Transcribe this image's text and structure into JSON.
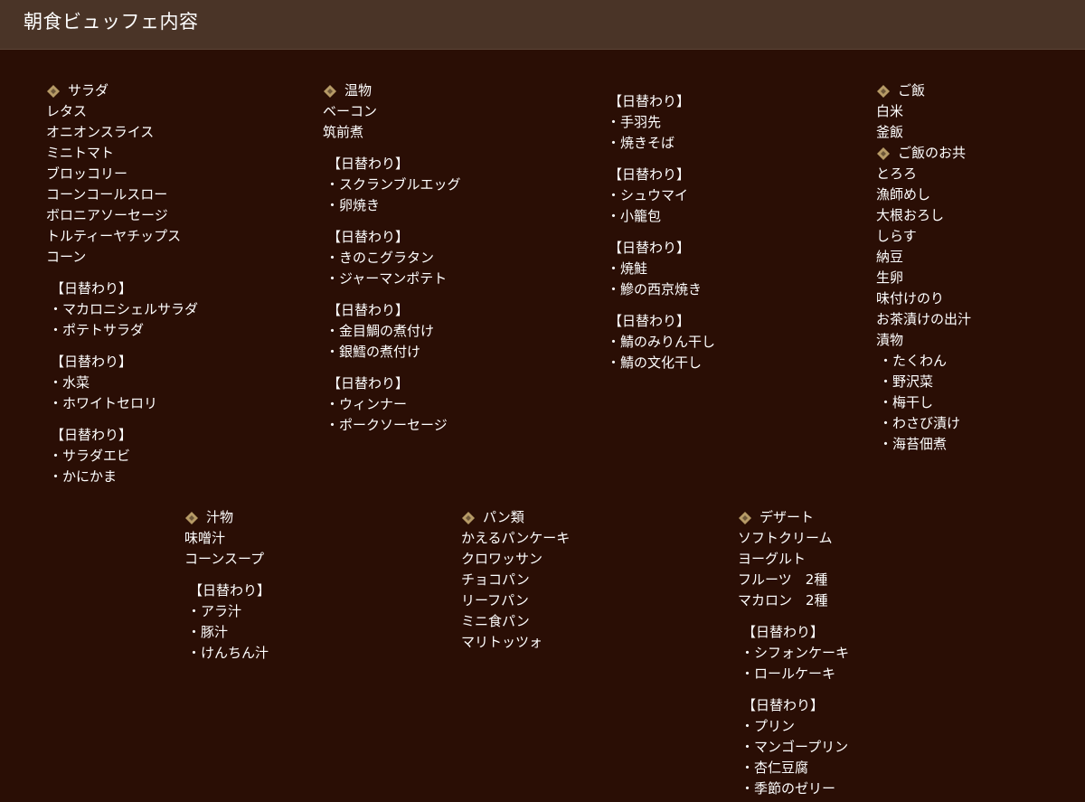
{
  "header": {
    "title": "朝食ビュッフェ内容"
  },
  "colors": {
    "background": "#2a0e05",
    "header_bar": "#4a3427",
    "diamond_gold": "#b69a66",
    "diamond_inner": "#6d5638",
    "text": "#ffffff"
  },
  "icons": {
    "category_marker": "diamond-bullet-icon"
  },
  "columns": [
    {
      "id": "c1",
      "blocks": [
        {
          "type": "heading",
          "text": "サラダ"
        },
        {
          "type": "item",
          "text": "レタス"
        },
        {
          "type": "item",
          "text": "オニオンスライス"
        },
        {
          "type": "item",
          "text": "ミニトマト"
        },
        {
          "type": "item",
          "text": "ブロッコリー"
        },
        {
          "type": "item",
          "text": "コーンコールスロー"
        },
        {
          "type": "item",
          "text": "ボロニアソーセージ"
        },
        {
          "type": "item",
          "text": "トルティーヤチップス"
        },
        {
          "type": "item",
          "text": "コーン"
        },
        {
          "type": "gap"
        },
        {
          "type": "subhead",
          "text": "【日替わり】"
        },
        {
          "type": "sub",
          "text": "・マカロニシェルサラダ"
        },
        {
          "type": "sub",
          "text": "・ポテトサラダ"
        },
        {
          "type": "gap"
        },
        {
          "type": "subhead",
          "text": "【日替わり】"
        },
        {
          "type": "sub",
          "text": "・水菜"
        },
        {
          "type": "sub",
          "text": "・ホワイトセロリ"
        },
        {
          "type": "gap"
        },
        {
          "type": "subhead",
          "text": "【日替わり】"
        },
        {
          "type": "sub",
          "text": "・サラダエビ"
        },
        {
          "type": "sub",
          "text": "・かにかま"
        }
      ]
    },
    {
      "id": "c2",
      "blocks": [
        {
          "type": "heading",
          "text": "温物"
        },
        {
          "type": "item",
          "text": "ベーコン"
        },
        {
          "type": "item",
          "text": "筑前煮"
        },
        {
          "type": "gap"
        },
        {
          "type": "subhead",
          "text": "【日替わり】"
        },
        {
          "type": "sub",
          "text": "・スクランブルエッグ"
        },
        {
          "type": "sub",
          "text": "・卵焼き"
        },
        {
          "type": "gap"
        },
        {
          "type": "subhead",
          "text": "【日替わり】"
        },
        {
          "type": "sub",
          "text": "・きのこグラタン"
        },
        {
          "type": "sub",
          "text": "・ジャーマンポテト"
        },
        {
          "type": "gap"
        },
        {
          "type": "subhead",
          "text": "【日替わり】"
        },
        {
          "type": "sub",
          "text": "・金目鯛の煮付け"
        },
        {
          "type": "sub",
          "text": "・銀鱈の煮付け"
        },
        {
          "type": "gap"
        },
        {
          "type": "subhead",
          "text": "【日替わり】"
        },
        {
          "type": "sub",
          "text": "・ウィンナー"
        },
        {
          "type": "sub",
          "text": "・ポークソーセージ"
        }
      ]
    },
    {
      "id": "c3",
      "blocks": [
        {
          "type": "subhead",
          "text": "【日替わり】"
        },
        {
          "type": "sub",
          "text": "・手羽先"
        },
        {
          "type": "sub",
          "text": "・焼きそば"
        },
        {
          "type": "gap"
        },
        {
          "type": "subhead",
          "text": "【日替わり】"
        },
        {
          "type": "sub",
          "text": "・シュウマイ"
        },
        {
          "type": "sub",
          "text": "・小籠包"
        },
        {
          "type": "gap"
        },
        {
          "type": "subhead",
          "text": "【日替わり】"
        },
        {
          "type": "sub",
          "text": "・焼鮭"
        },
        {
          "type": "sub",
          "text": "・鰺の西京焼き"
        },
        {
          "type": "gap"
        },
        {
          "type": "subhead",
          "text": "【日替わり】"
        },
        {
          "type": "sub",
          "text": "・鯖のみりん干し"
        },
        {
          "type": "sub",
          "text": "・鯖の文化干し"
        }
      ]
    },
    {
      "id": "c4",
      "blocks": [
        {
          "type": "heading",
          "text": "ご飯"
        },
        {
          "type": "item",
          "text": "白米"
        },
        {
          "type": "item",
          "text": "釜飯"
        },
        {
          "type": "heading",
          "text": "ご飯のお共"
        },
        {
          "type": "item",
          "text": "とろろ"
        },
        {
          "type": "item",
          "text": "漁師めし"
        },
        {
          "type": "item",
          "text": "大根おろし"
        },
        {
          "type": "item",
          "text": "しらす"
        },
        {
          "type": "item",
          "text": "納豆"
        },
        {
          "type": "item",
          "text": "生卵"
        },
        {
          "type": "item",
          "text": "味付けのり"
        },
        {
          "type": "item",
          "text": "お茶漬けの出汁"
        },
        {
          "type": "item",
          "text": "漬物"
        },
        {
          "type": "sub",
          "text": "・たくわん"
        },
        {
          "type": "sub",
          "text": "・野沢菜"
        },
        {
          "type": "sub",
          "text": "・梅干し"
        },
        {
          "type": "sub",
          "text": "・わさび漬け"
        },
        {
          "type": "sub",
          "text": "・海苔佃煮"
        }
      ]
    },
    {
      "id": "c5",
      "blocks": [
        {
          "type": "heading",
          "text": "汁物"
        },
        {
          "type": "item",
          "text": "味噌汁"
        },
        {
          "type": "item",
          "text": "コーンスープ"
        },
        {
          "type": "gap"
        },
        {
          "type": "subhead",
          "text": "【日替わり】"
        },
        {
          "type": "sub",
          "text": "・アラ汁"
        },
        {
          "type": "sub",
          "text": "・豚汁"
        },
        {
          "type": "sub",
          "text": "・けんちん汁"
        }
      ]
    },
    {
      "id": "c6",
      "blocks": [
        {
          "type": "heading",
          "text": "パン類"
        },
        {
          "type": "item",
          "text": "かえるパンケーキ"
        },
        {
          "type": "item",
          "text": "クロワッサン"
        },
        {
          "type": "item",
          "text": "チョコパン"
        },
        {
          "type": "item",
          "text": "リーフパン"
        },
        {
          "type": "item",
          "text": "ミニ食パン"
        },
        {
          "type": "item",
          "text": "マリトッツォ"
        }
      ]
    },
    {
      "id": "c7",
      "blocks": [
        {
          "type": "heading",
          "text": "デザート"
        },
        {
          "type": "item",
          "text": "ソフトクリーム"
        },
        {
          "type": "item",
          "text": "ヨーグルト"
        },
        {
          "type": "item",
          "text": "フルーツ　2種"
        },
        {
          "type": "item",
          "text": "マカロン　2種"
        },
        {
          "type": "gap"
        },
        {
          "type": "subhead",
          "text": "【日替わり】"
        },
        {
          "type": "sub",
          "text": "・シフォンケーキ"
        },
        {
          "type": "sub",
          "text": "・ロールケーキ"
        },
        {
          "type": "gap"
        },
        {
          "type": "subhead",
          "text": "【日替わり】"
        },
        {
          "type": "sub",
          "text": "・プリン"
        },
        {
          "type": "sub",
          "text": "・マンゴープリン"
        },
        {
          "type": "sub",
          "text": "・杏仁豆腐"
        },
        {
          "type": "sub",
          "text": "・季節のゼリー"
        }
      ]
    }
  ]
}
